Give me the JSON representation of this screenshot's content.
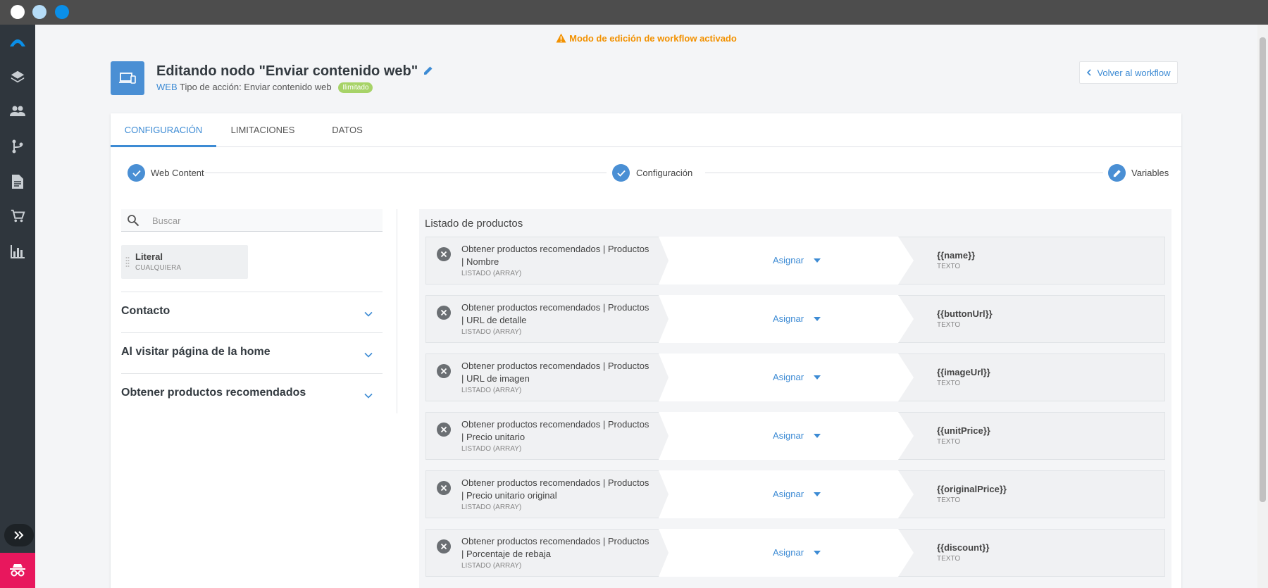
{
  "banner": {
    "text": "Modo de edición de workflow activado"
  },
  "node": {
    "title": "Editando nodo \"Enviar contenido web\"",
    "channel": "WEB",
    "action_type": "Tipo de acción: Enviar contenido web",
    "badge": "Ilimitado"
  },
  "back_button": {
    "label": "Volver al workflow"
  },
  "tabs": [
    {
      "label": "CONFIGURACIÓN",
      "active": true
    },
    {
      "label": "LIMITACIONES",
      "active": false
    },
    {
      "label": "DATOS",
      "active": false
    }
  ],
  "steps": [
    {
      "label": "Web Content",
      "state": "done"
    },
    {
      "label": "Configuración",
      "state": "done"
    },
    {
      "label": "Variables",
      "state": "editing"
    }
  ],
  "search": {
    "placeholder": "Buscar"
  },
  "literal": {
    "name": "Literal",
    "type": "CUALQUIERA"
  },
  "groups": [
    {
      "label": "Contacto"
    },
    {
      "label": "Al visitar página de la home"
    },
    {
      "label": "Obtener productos recomendados"
    }
  ],
  "list": {
    "title": "Listado de productos",
    "assign_label": "Asignar",
    "rows": [
      {
        "source_line1": "Obtener productos recomendados | Productos",
        "source_line2": "| Nombre",
        "source_type": "LISTADO (ARRAY)",
        "target": "{{name}}",
        "target_type": "TEXTO"
      },
      {
        "source_line1": "Obtener productos recomendados | Productos",
        "source_line2": "| URL de detalle",
        "source_type": "LISTADO (ARRAY)",
        "target": "{{buttonUrl}}",
        "target_type": "TEXTO"
      },
      {
        "source_line1": "Obtener productos recomendados | Productos",
        "source_line2": "| URL de imagen",
        "source_type": "LISTADO (ARRAY)",
        "target": "{{imageUrl}}",
        "target_type": "TEXTO"
      },
      {
        "source_line1": "Obtener productos recomendados | Productos",
        "source_line2": "| Precio unitario",
        "source_type": "LISTADO (ARRAY)",
        "target": "{{unitPrice}}",
        "target_type": "TEXTO"
      },
      {
        "source_line1": "Obtener productos recomendados | Productos",
        "source_line2": "| Precio unitario original",
        "source_type": "LISTADO (ARRAY)",
        "target": "{{originalPrice}}",
        "target_type": "TEXTO"
      },
      {
        "source_line1": "Obtener productos recomendados | Productos",
        "source_line2": "| Porcentaje de rebaja",
        "source_type": "LISTADO (ARRAY)",
        "target": "{{discount}}",
        "target_type": "TEXTO"
      }
    ]
  },
  "colors": {
    "accent": "#3d8bd4",
    "warning": "#f29100",
    "rail": "#2f363d",
    "badge": "#a7d368",
    "rail_bottom": "#e8175d"
  },
  "icons": {
    "rail": [
      "logo-icon",
      "layers-icon",
      "users-icon",
      "workflow-icon",
      "document-icon",
      "cart-icon",
      "chart-icon"
    ],
    "rail_expand": "double-chevron-right-icon",
    "rail_bottom": "incognito-icon"
  }
}
